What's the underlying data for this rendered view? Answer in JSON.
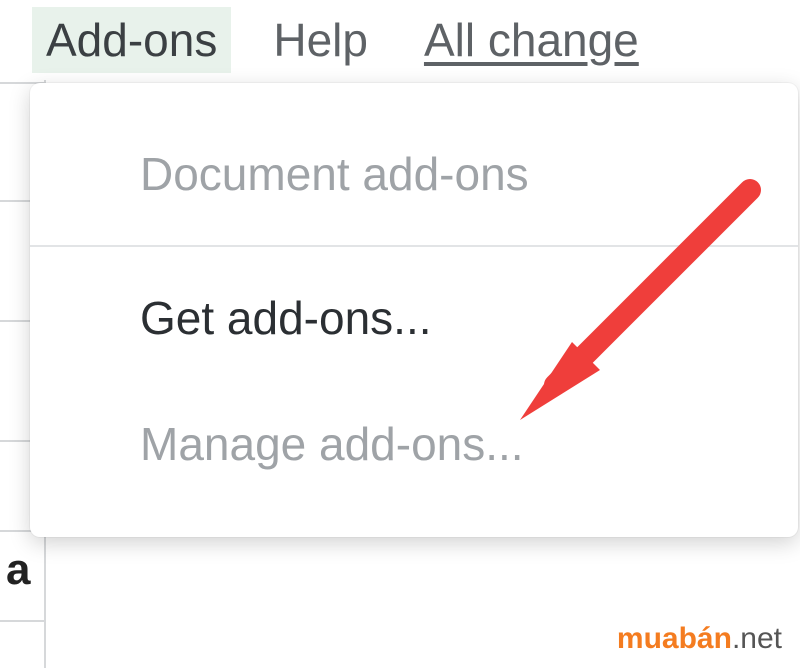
{
  "menubar": {
    "addons": "Add-ons",
    "help": "Help",
    "status": "All change"
  },
  "dropdown": {
    "document_addons": "Document add-ons",
    "get_addons": "Get add-ons...",
    "manage_addons": "Manage add-ons..."
  },
  "cell": {
    "a": "a"
  },
  "watermark": {
    "brand": "muabán",
    "tld": ".net"
  },
  "colors": {
    "arrow": "#ef3e3b"
  }
}
